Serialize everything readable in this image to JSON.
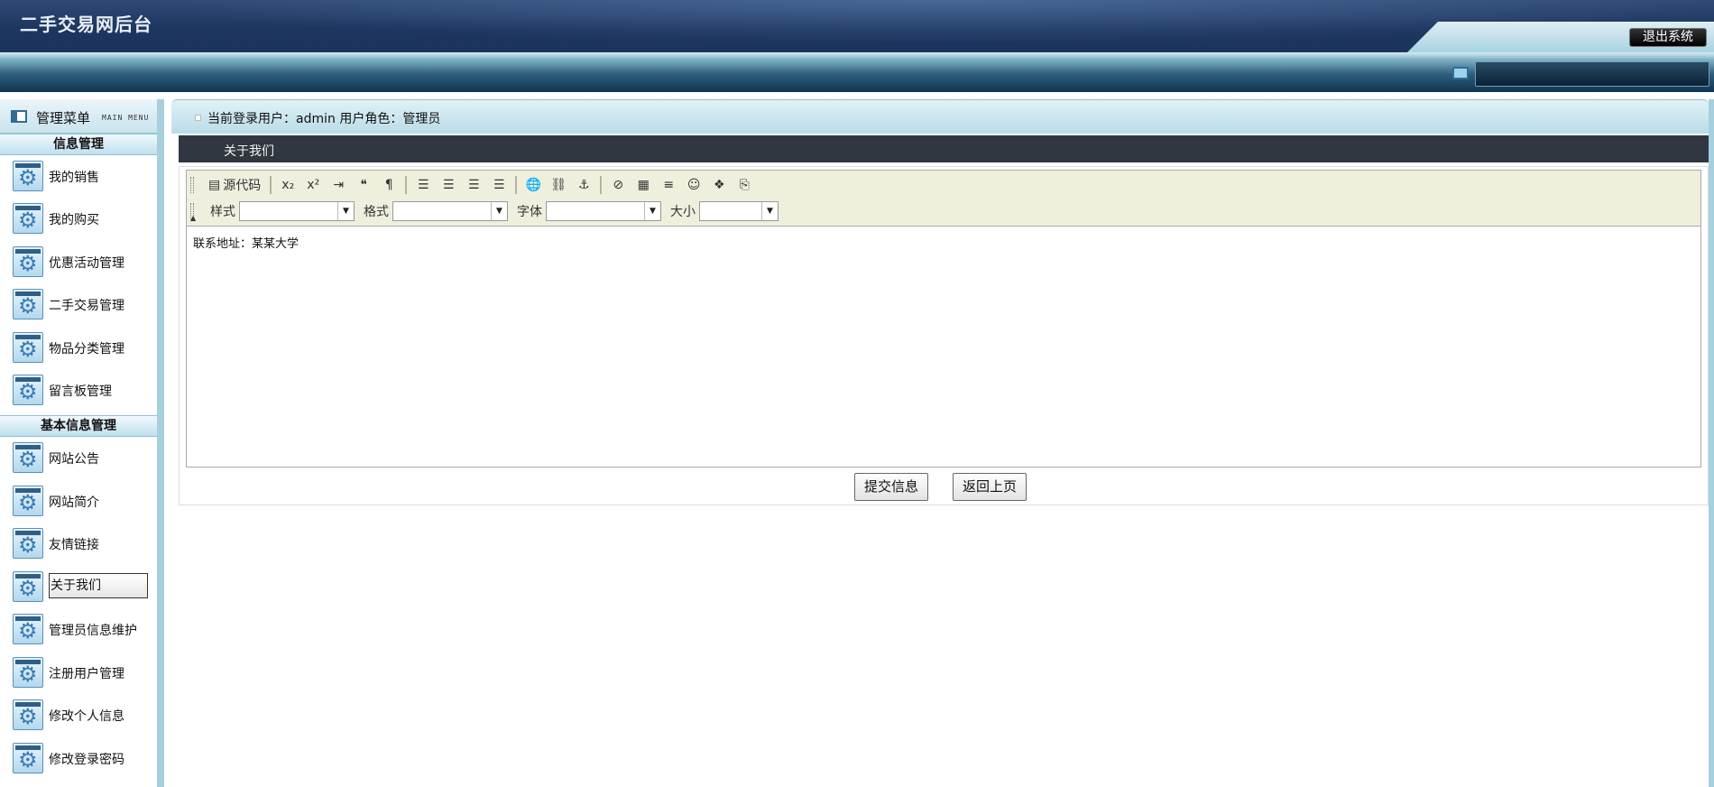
{
  "header": {
    "title": "二手交易网后台",
    "logout_label": "退出系统"
  },
  "sidebar": {
    "head_label": "管理菜单",
    "head_sub": "MAIN MENU",
    "sections": [
      {
        "title": "信息管理",
        "items": [
          {
            "label": "我的销售"
          },
          {
            "label": "我的购买"
          },
          {
            "label": "优惠活动管理"
          },
          {
            "label": "二手交易管理"
          },
          {
            "label": "物品分类管理"
          },
          {
            "label": "留言板管理"
          }
        ]
      },
      {
        "title": "基本信息管理",
        "items": [
          {
            "label": "网站公告"
          },
          {
            "label": "网站简介"
          },
          {
            "label": "友情链接"
          },
          {
            "label": "关于我们",
            "active": true
          },
          {
            "label": "管理员信息维护"
          },
          {
            "label": "注册用户管理"
          },
          {
            "label": "修改个人信息"
          },
          {
            "label": "修改登录密码"
          }
        ]
      }
    ]
  },
  "userbar": {
    "text": "当前登录用户：admin  用户角色：管理员"
  },
  "page": {
    "title": "关于我们"
  },
  "editor": {
    "source_label": "源代码",
    "style_label": "样式",
    "format_label": "格式",
    "font_label": "字体",
    "size_label": "大小",
    "content": "联系地址：某某大学"
  },
  "buttons": {
    "submit": "提交信息",
    "back": "返回上页"
  }
}
